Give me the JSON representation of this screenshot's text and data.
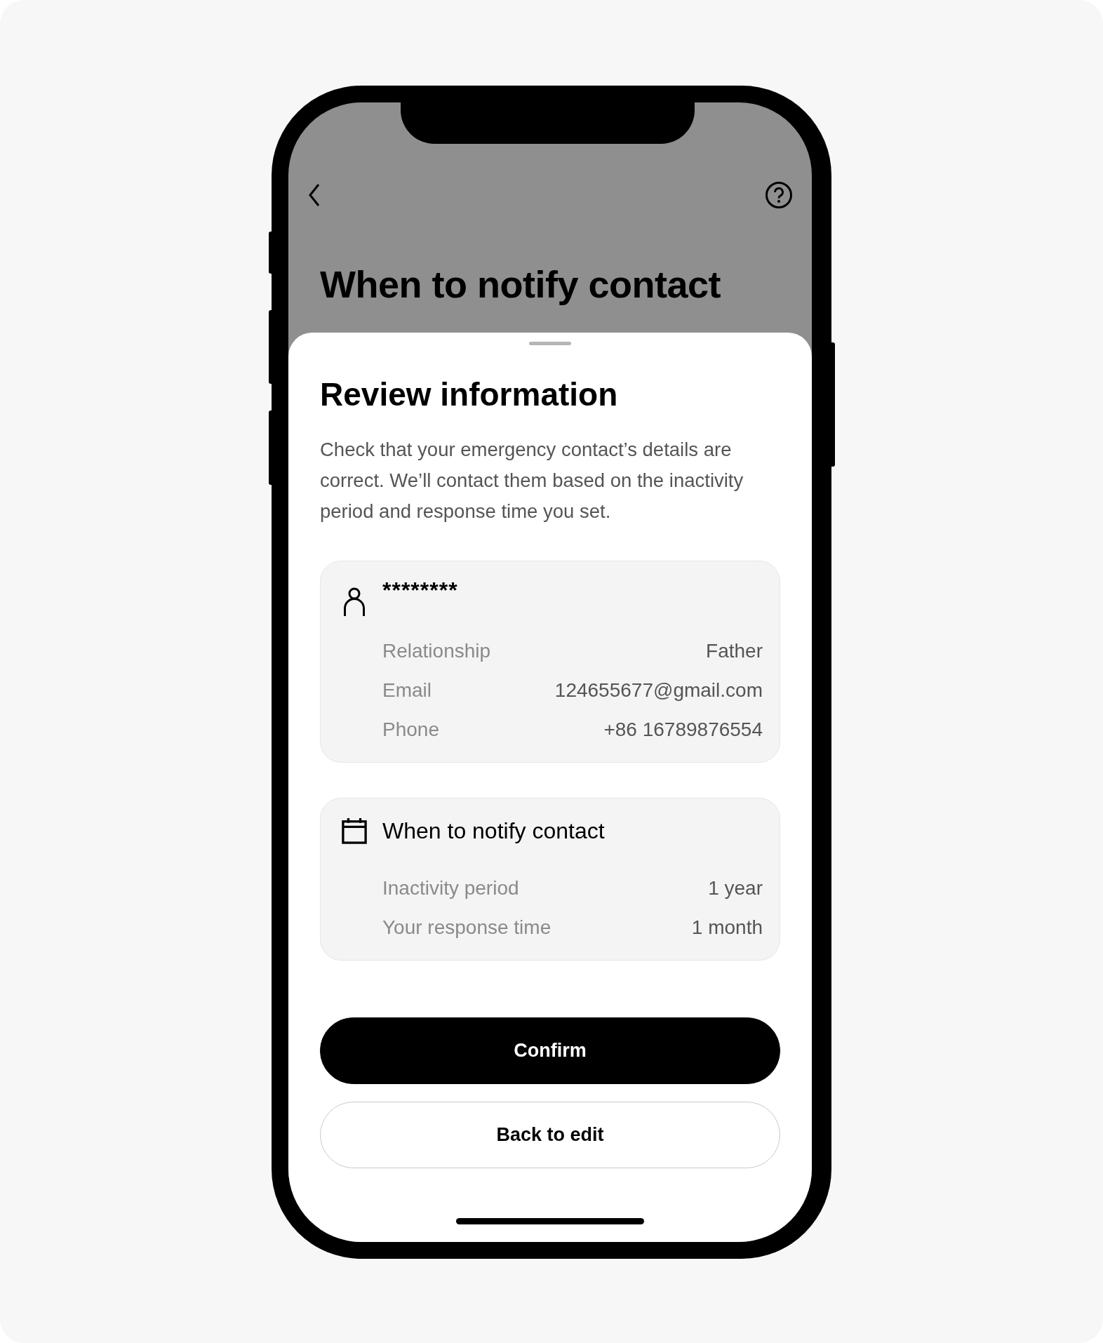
{
  "header": {
    "title": "When to notify contact"
  },
  "sheet": {
    "title": "Review information",
    "description": "Check that your emergency contact’s details are correct. We’ll contact them based on the inactivity period and response time you set.",
    "cards": [
      {
        "kind": "contact",
        "title": "********",
        "rows": [
          {
            "label": "Relationship",
            "value": "Father"
          },
          {
            "label": "Email",
            "value": "124655677@gmail.com"
          },
          {
            "label": "Phone",
            "value": "+86 16789876554"
          }
        ]
      },
      {
        "kind": "schedule",
        "title": "When to notify contact",
        "rows": [
          {
            "label": "Inactivity period",
            "value": "1 year"
          },
          {
            "label": "Your response time",
            "value": "1 month"
          }
        ]
      }
    ],
    "buttons": [
      {
        "kind": "primary",
        "label": "Confirm"
      },
      {
        "kind": "secondary",
        "label": "Back to edit"
      }
    ]
  }
}
